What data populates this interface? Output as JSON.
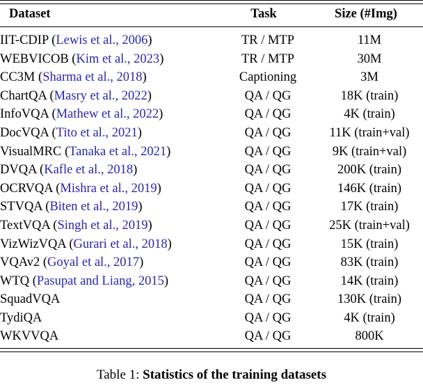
{
  "table": {
    "columns": [
      "Dataset",
      "Task",
      "Size (#Img)"
    ],
    "rows": [
      {
        "name": "IIT-CDIP",
        "citation": "Lewis et al., 2006",
        "task": "TR / MTP",
        "size": "11M"
      },
      {
        "name": "WEBVICOB",
        "citation": "Kim et al., 2023",
        "task": "TR / MTP",
        "size": "30M"
      },
      {
        "name": "CC3M",
        "citation": "Sharma et al., 2018",
        "task": "Captioning",
        "size": "3M"
      },
      {
        "name": "ChartQA",
        "citation": "Masry et al., 2022",
        "task": "QA / QG",
        "size": "18K (train)"
      },
      {
        "name": "InfoVQA",
        "citation": "Mathew et al., 2022",
        "task": "QA / QG",
        "size": "4K (train)"
      },
      {
        "name": "DocVQA",
        "citation": "Tito et al., 2021",
        "task": "QA / QG",
        "size": "11K (train+val)"
      },
      {
        "name": "VisualMRC",
        "citation": "Tanaka et al., 2021",
        "task": "QA / QG",
        "size": "9K (train+val)"
      },
      {
        "name": "DVQA",
        "citation": "Kafle et al., 2018",
        "task": "QA / QG",
        "size": "200K (train)"
      },
      {
        "name": "OCRVQA",
        "citation": "Mishra et al., 2019",
        "task": "QA / QG",
        "size": "146K (train)"
      },
      {
        "name": "STVQA",
        "citation": "Biten et al., 2019",
        "task": "QA / QG",
        "size": "17K (train)"
      },
      {
        "name": "TextVQA",
        "citation": "Singh et al., 2019",
        "task": "QA / QG",
        "size": "25K (train+val)"
      },
      {
        "name": "VizWizVQA",
        "citation": "Gurari et al., 2018",
        "task": "QA / QG",
        "size": "15K (train)"
      },
      {
        "name": "VQAv2",
        "citation": "Goyal et al., 2017",
        "task": "QA / QG",
        "size": "83K (train)"
      },
      {
        "name": "WTQ",
        "citation": "Pasupat and Liang, 2015",
        "task": "QA / QG",
        "size": "14K (train)"
      },
      {
        "name": "SquadVQA",
        "citation": "",
        "task": "QA / QG",
        "size": "130K (train)"
      },
      {
        "name": "TydiQA",
        "citation": "",
        "task": "QA / QG",
        "size": "4K (train)"
      },
      {
        "name": "WKVVQA",
        "citation": "",
        "task": "QA / QG",
        "size": "800K"
      }
    ]
  },
  "caption": {
    "label": "Table 1: ",
    "title": "Statistics of the training datasets"
  },
  "colors": {
    "citation_link": "#2626B0",
    "text": "#000000",
    "background": "#ffffff"
  }
}
